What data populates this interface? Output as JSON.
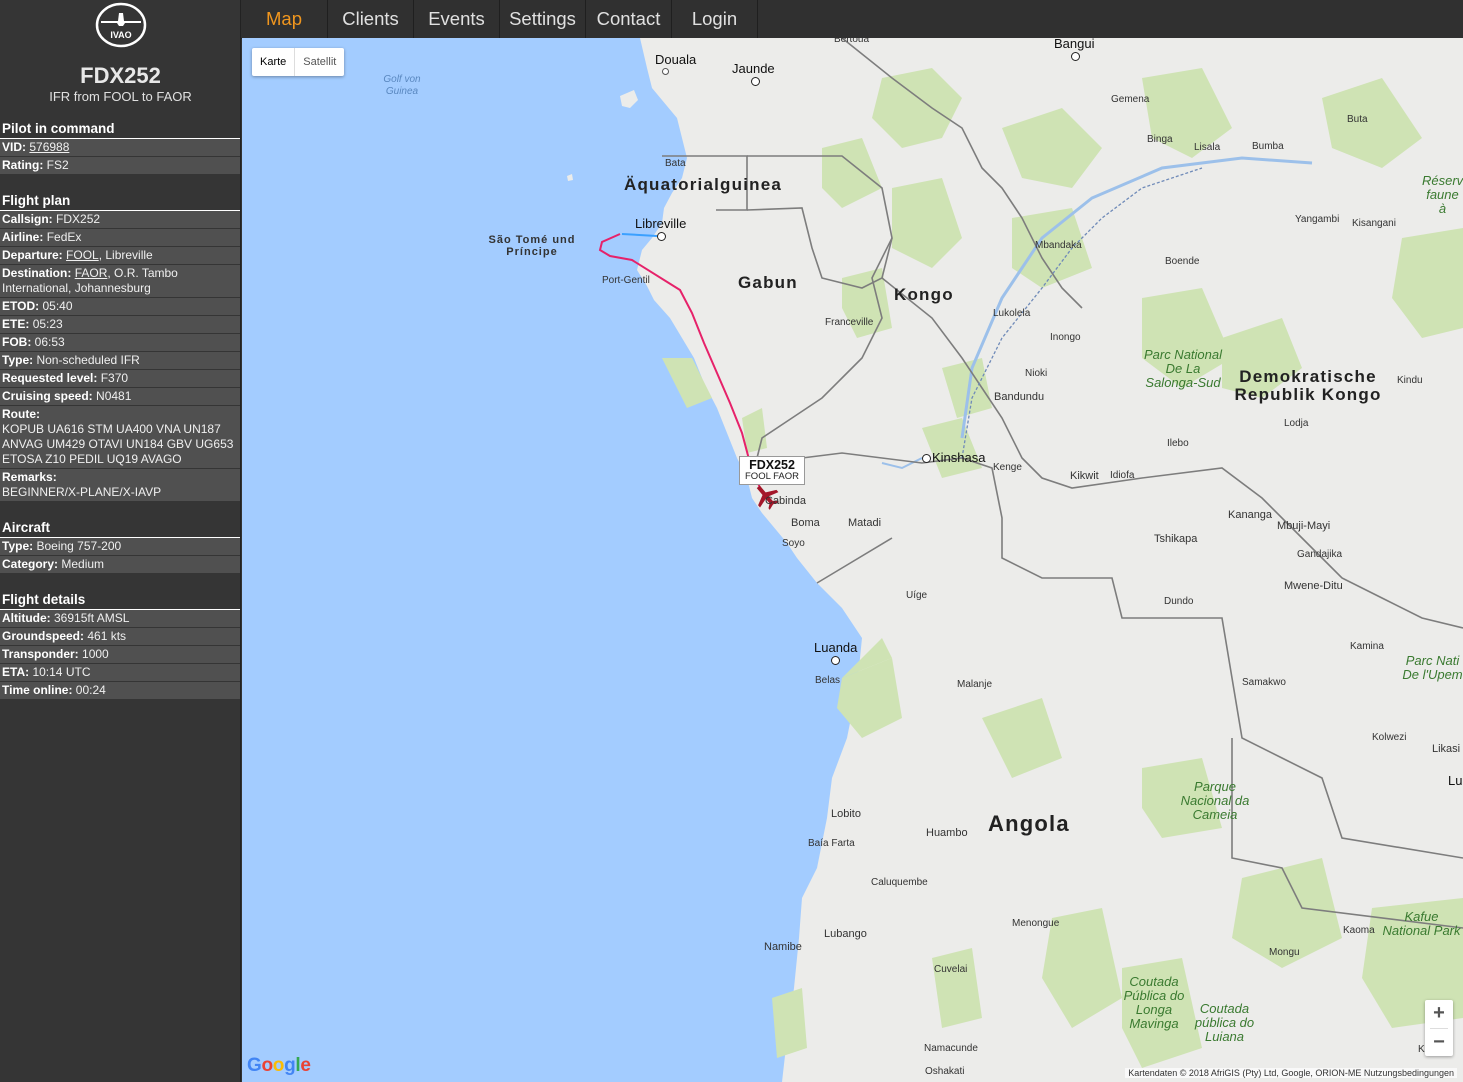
{
  "nav": {
    "tabs": [
      {
        "label": "Map",
        "active": true
      },
      {
        "label": "Clients"
      },
      {
        "label": "Events"
      },
      {
        "label": "Settings"
      },
      {
        "label": "Contact"
      },
      {
        "label": "Login"
      }
    ]
  },
  "sidebar": {
    "logo_text": "IVAO",
    "callsign": "FDX252",
    "subtitle": "IFR from FOOL to FAOR",
    "pilot": {
      "heading": "Pilot in command",
      "vid_label": "VID:",
      "vid": "576988",
      "rating_label": "Rating:",
      "rating": "FS2"
    },
    "flightplan": {
      "heading": "Flight plan",
      "callsign_label": "Callsign:",
      "callsign": "FDX252",
      "airline_label": "Airline:",
      "airline": "FedEx",
      "departure_label": "Departure:",
      "departure_code": "FOOL",
      "departure_name": ", Libreville",
      "destination_label": "Destination:",
      "destination_code": "FAOR",
      "destination_name": ", O.R. Tambo International, Johannesburg",
      "etod_label": "ETOD:",
      "etod": "05:40",
      "ete_label": "ETE:",
      "ete": "05:23",
      "fob_label": "FOB:",
      "fob": "06:53",
      "type_label": "Type:",
      "type": "Non-scheduled IFR",
      "level_label": "Requested level:",
      "level": "F370",
      "speed_label": "Cruising speed:",
      "speed": "N0481",
      "route_label": "Route:",
      "route": "KOPUB UA616 STM UA400 VNA UN187 ANVAG UM429 OTAVI UN184 GBV UG653 ETOSA Z10 PEDIL UQ19 AVAGO",
      "remarks_label": "Remarks:",
      "remarks": "BEGINNER/X-PLANE/X-IAVP"
    },
    "aircraft": {
      "heading": "Aircraft",
      "type_label": "Type:",
      "type": "Boeing 757-200",
      "category_label": "Category:",
      "category": "Medium"
    },
    "details": {
      "heading": "Flight details",
      "altitude_label": "Altitude:",
      "altitude": "36915ft AMSL",
      "groundspeed_label": "Groundspeed:",
      "groundspeed": "461 kts",
      "transponder_label": "Transponder:",
      "transponder": "1000",
      "eta_label": "ETA:",
      "eta": "10:14 UTC",
      "online_label": "Time online:",
      "online": "00:24"
    }
  },
  "map": {
    "type_toggle": {
      "map": "Karte",
      "satellite": "Satellit"
    },
    "flight_label": {
      "callsign": "FDX252",
      "route": "FOOL FAOR"
    },
    "zoom": {
      "in": "+",
      "out": "−"
    },
    "google": "Google",
    "attribution": "Kartendaten © 2018 AfriGIS (Pty) Ltd, Google, ORION-ME    Nutzungsbedingungen",
    "labels": {
      "bertoua": "Bertoua",
      "bangui": "Bangui",
      "douala": "Douala",
      "jaunde": "Jaunde",
      "golf": "Golf von Guinea",
      "gemena": "Gemena",
      "buta": "Buta",
      "binga": "Binga",
      "lisala": "Lisala",
      "bumba": "Bumba",
      "reserve": "Réserv faune à",
      "bata": "Bata",
      "aequatorial": "Äquatorialguinea",
      "saotome": "São Tomé und Príncipe",
      "libreville": "Libreville",
      "yangambi": "Yangambi",
      "kisangani": "Kisangani",
      "mbandaka": "Mbandaka",
      "boende": "Boende",
      "portgentil": "Port-Gentil",
      "gabun": "Gabun",
      "kongo": "Kongo",
      "lukolela": "Lukolela",
      "inongo": "Inongo",
      "franceville": "Franceville",
      "salonga": "Parc National De La Salonga-Sud",
      "drk": "Demokratische Republik Kongo",
      "kindu": "Kindu",
      "nioki": "Nioki",
      "bandundu": "Bandundu",
      "lodja": "Lodja",
      "ilebo": "Ilebo",
      "kinshasa": "Kinshasa",
      "kenge": "Kenge",
      "kikwit": "Kikwit",
      "idiofa": "Idiofa",
      "cabinda": "Cabinda",
      "boma": "Boma",
      "matadi": "Matadi",
      "soyo": "Soyo",
      "kananga": "Kananga",
      "mbujimayi": "Mbuji-Mayi",
      "tshikapa": "Tshikapa",
      "gandajika": "Gandajika",
      "mweneditu": "Mwene-Ditu",
      "dundo": "Dundo",
      "uige": "Uíge",
      "luanda": "Luanda",
      "belas": "Belas",
      "kamina": "Kamina",
      "parcupemba": "Parc Nati De l'Upem",
      "malanje": "Malanje",
      "samakwo": "Samakwo",
      "kolwezi": "Kolwezi",
      "likasi": "Likasi",
      "lu": "Lu",
      "cameia": "Parque Nacional da Cameia",
      "lobito": "Lobito",
      "huambo": "Huambo",
      "angola": "Angola",
      "baiafarta": "Baía Farta",
      "caluquembe": "Caluquembe",
      "menongue": "Menongue",
      "kafue": "Kafue National Park",
      "kaoma": "Kaoma",
      "mongu": "Mongu",
      "namibe": "Namibe",
      "lubango": "Lubango",
      "cuvelai": "Cuvelai",
      "longa": "Coutada Pública do Longa Mavinga",
      "luiana": "Coutada pública do Luiana",
      "namacunde": "Namacunde",
      "oshakati": "Oshakati",
      "k": "K"
    }
  }
}
